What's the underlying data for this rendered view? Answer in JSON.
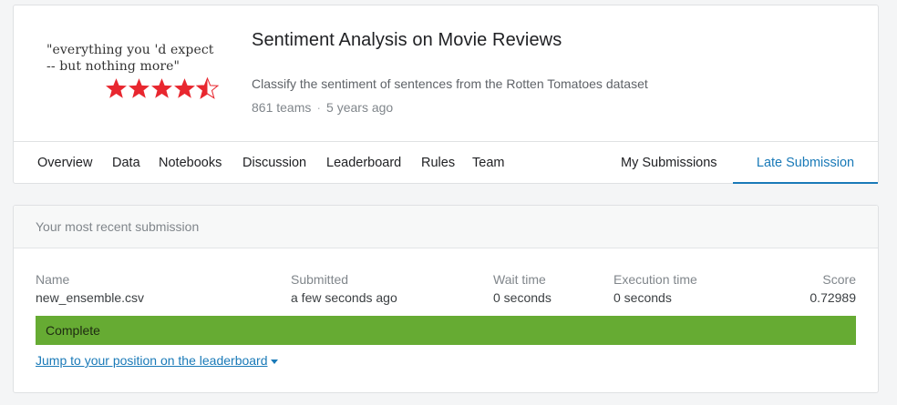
{
  "competition": {
    "title": "Sentiment Analysis on Movie Reviews",
    "description": "Classify the sentiment of sentences from the Rotten Tomatoes dataset",
    "teams": "861 teams",
    "separator": "·",
    "age": "5 years ago",
    "thumbnail": {
      "quote": "\"everything you 'd expect\n-- but nothing more\"",
      "rating_stars": 4.5,
      "star_color": "#e8272f"
    }
  },
  "tabs": {
    "left": [
      "Overview",
      "Data",
      "Notebooks",
      "Discussion",
      "Leaderboard",
      "Rules",
      "Team"
    ],
    "my_submissions": "My Submissions",
    "late_submission": "Late Submission"
  },
  "submission": {
    "heading": "Your most recent submission",
    "columns": {
      "name": {
        "label": "Name",
        "value": "new_ensemble.csv"
      },
      "submitted": {
        "label": "Submitted",
        "value": "a few seconds ago"
      },
      "wait_time": {
        "label": "Wait time",
        "value": "0 seconds"
      },
      "execution_time": {
        "label": "Execution time",
        "value": "0 seconds"
      },
      "score": {
        "label": "Score",
        "value": "0.72989"
      }
    },
    "status": "Complete",
    "status_color": "#66ab33",
    "jump_link": "Jump to your position on the leaderboard"
  },
  "colors": {
    "accent": "#1a7ab8"
  }
}
